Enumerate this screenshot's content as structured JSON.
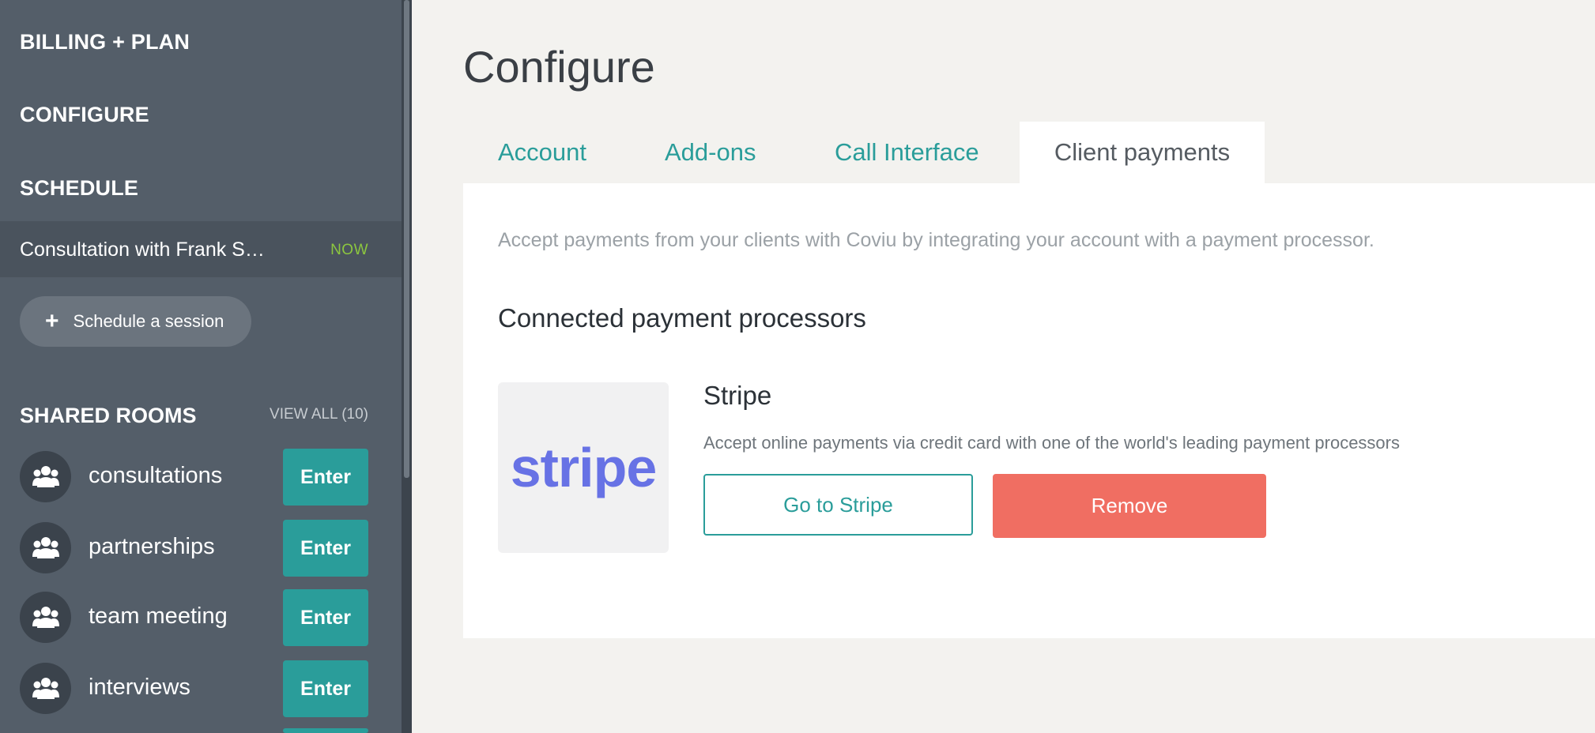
{
  "sidebar": {
    "nav": {
      "billing": "BILLING + PLAN",
      "configure": "CONFIGURE",
      "schedule": "SCHEDULE"
    },
    "current_session": {
      "label": "Consultation with Frank S…",
      "status": "NOW"
    },
    "schedule_button": "Schedule a session",
    "shared_rooms": {
      "heading": "SHARED ROOMS",
      "view_all": "VIEW ALL (10)",
      "rooms": [
        {
          "name": "consultations",
          "action": "Enter"
        },
        {
          "name": "partnerships",
          "action": "Enter"
        },
        {
          "name": "team meeting",
          "action": "Enter"
        },
        {
          "name": "interviews",
          "action": "Enter"
        }
      ]
    }
  },
  "main": {
    "title": "Configure",
    "tabs": [
      "Account",
      "Add-ons",
      "Call Interface",
      "Client payments"
    ],
    "active_tab": "Client payments",
    "intro": "Accept payments from your clients with Coviu by integrating your account with a payment processor.",
    "section_title": "Connected payment processors",
    "processor": {
      "logo_text": "stripe",
      "name": "Stripe",
      "description": "Accept online payments via credit card with one of the world's leading payment processors",
      "go_button": "Go to Stripe",
      "remove_button": "Remove"
    }
  },
  "colors": {
    "sidebar_bg": "#545e69",
    "accent_teal": "#2a9d9a",
    "remove_red": "#f06e62",
    "stripe_purple": "#6772e5",
    "now_green": "#8cc63f"
  }
}
